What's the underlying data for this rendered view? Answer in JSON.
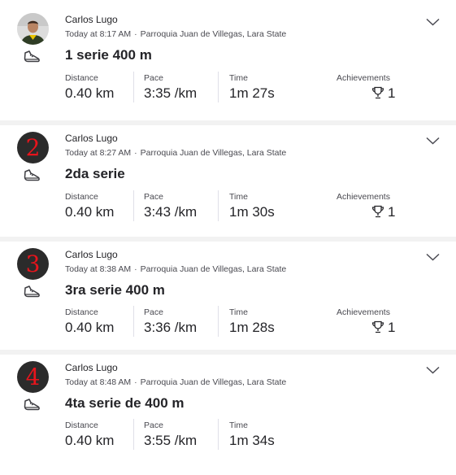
{
  "labels": {
    "distance": "Distance",
    "pace": "Pace",
    "time": "Time",
    "achievements": "Achievements"
  },
  "activities": [
    {
      "athlete": "Carlos Lugo",
      "avatar_type": "photo",
      "avatar_icon": "profile-photo",
      "timestamp": "Today at 8:17 AM",
      "location": "Parroquia Juan de Villegas, Lara State",
      "title": "1 serie 400 m",
      "distance": "0.40 km",
      "pace": "3:35 /km",
      "time": "1m 27s",
      "achievements": "1"
    },
    {
      "athlete": "Carlos Lugo",
      "avatar_type": "number",
      "avatar_number": "2",
      "timestamp": "Today at 8:27 AM",
      "location": "Parroquia Juan de Villegas, Lara State",
      "title": "2da serie",
      "distance": "0.40 km",
      "pace": "3:43 /km",
      "time": "1m 30s",
      "achievements": "1"
    },
    {
      "athlete": "Carlos Lugo",
      "avatar_type": "number",
      "avatar_number": "3",
      "timestamp": "Today at 8:38 AM",
      "location": "Parroquia Juan de Villegas, Lara State",
      "title": "3ra serie 400 m",
      "distance": "0.40 km",
      "pace": "3:36 /km",
      "time": "1m 28s",
      "achievements": "1"
    },
    {
      "athlete": "Carlos Lugo",
      "avatar_type": "number",
      "avatar_number": "4",
      "timestamp": "Today at 8:48 AM",
      "location": "Parroquia Juan de Villegas, Lara State",
      "title": "4ta serie de 400 m",
      "distance": "0.40 km",
      "pace": "3:55 /km",
      "time": "1m 34s"
    }
  ],
  "icons": {
    "activity_type": "running-shoe-icon",
    "expand": "chevron-down-icon",
    "achievement": "trophy-icon"
  },
  "colors": {
    "badge_number": "#e8141c",
    "badge_background": "#2b2b2b",
    "text_primary": "#242428",
    "text_secondary": "#494950",
    "divider": "#f2f2f2"
  }
}
